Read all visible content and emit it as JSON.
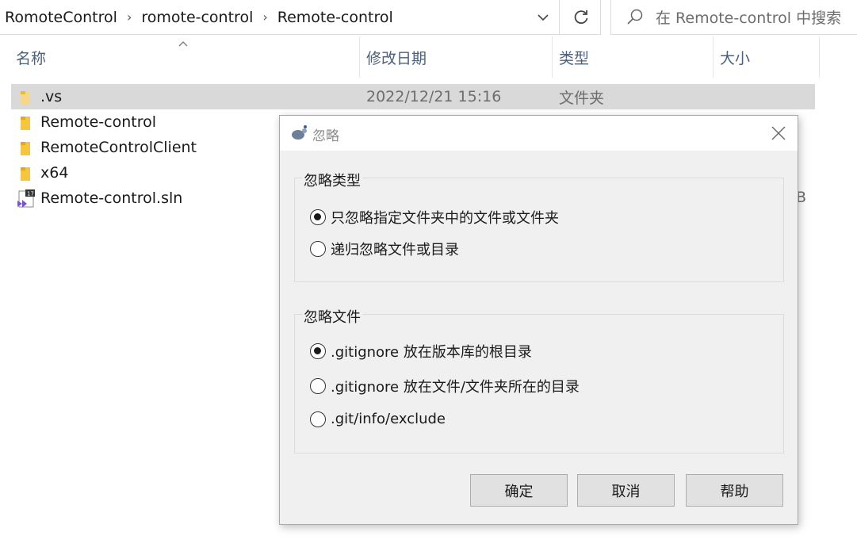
{
  "address_bar": {
    "crumbs": [
      "RomoteControl",
      "romote-control",
      "Remote-control"
    ]
  },
  "search": {
    "placeholder": "在 Remote-control 中搜索"
  },
  "columns": {
    "name": "名称",
    "modified": "修改日期",
    "type": "类型",
    "size": "大小"
  },
  "files": [
    {
      "name": ".vs",
      "modified": "2022/12/21 15:16",
      "type": "文件夹",
      "icon": "folder-icon",
      "selected": true
    },
    {
      "name": "Remote-control",
      "modified": "",
      "type": "",
      "icon": "folder-icon",
      "selected": false
    },
    {
      "name": "RemoteControlClient",
      "modified": "",
      "type": "",
      "icon": "folder-icon",
      "selected": false
    },
    {
      "name": "x64",
      "modified": "",
      "type": "",
      "icon": "folder-icon",
      "selected": false
    },
    {
      "name": "Remote-control.sln",
      "modified": "",
      "type": "",
      "icon": "visual-studio-solution-icon",
      "selected": false
    }
  ],
  "size_peek": "B",
  "dialog": {
    "title": "忽略",
    "ignore_type": {
      "label": "忽略类型",
      "options": [
        {
          "label": "只忽略指定文件夹中的文件或文件夹",
          "checked": true
        },
        {
          "label": "递归忽略文件或目录",
          "checked": false
        }
      ]
    },
    "ignore_file": {
      "label": "忽略文件",
      "options": [
        {
          "label": ".gitignore 放在版本库的根目录",
          "checked": true
        },
        {
          "label": ".gitignore 放在文件/文件夹所在的目录",
          "checked": false
        },
        {
          "label": ".git/info/exclude",
          "checked": false
        }
      ]
    },
    "buttons": {
      "ok": "确定",
      "cancel": "取消",
      "help": "帮助"
    }
  },
  "colors": {
    "folder": "#f5c542",
    "selection": "#d9d9d9",
    "dialog_bg": "#f0f0f0",
    "header_text": "#4c607a"
  }
}
